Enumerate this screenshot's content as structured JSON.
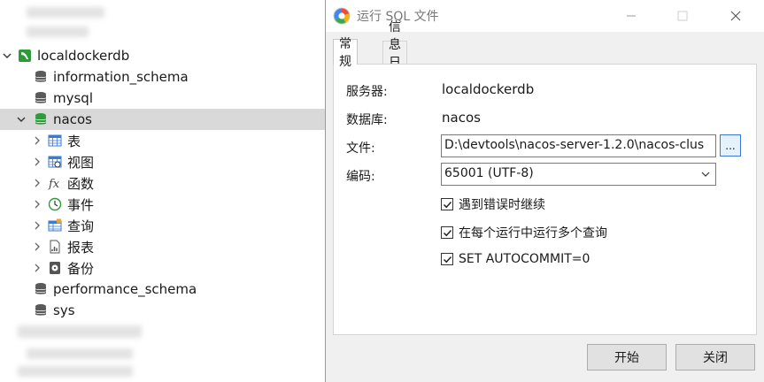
{
  "tree": {
    "connection": "localdockerdb",
    "databases": [
      "information_schema",
      "mysql",
      "nacos",
      "performance_schema",
      "sys"
    ],
    "nacos_children": [
      "表",
      "视图",
      "函数",
      "事件",
      "查询",
      "报表",
      "备份"
    ]
  },
  "dialog": {
    "title": "运行 SQL 文件",
    "tabs": [
      "常规",
      "信息日志"
    ],
    "fields": {
      "server_label": "服务器:",
      "server_value": "localdockerdb",
      "database_label": "数据库:",
      "database_value": "nacos",
      "file_label": "文件:",
      "file_value": "D:\\devtools\\nacos-server-1.2.0\\nacos-clus",
      "browse_label": "...",
      "encoding_label": "编码:",
      "encoding_value": "65001 (UTF-8)"
    },
    "options": [
      {
        "label": "遇到错误时继续",
        "checked": true
      },
      {
        "label": "在每个运行中运行多个查询",
        "checked": true
      },
      {
        "label": "SET AUTOCOMMIT=0",
        "checked": true
      }
    ],
    "buttons": {
      "start": "开始",
      "close": "关闭"
    }
  },
  "colors": {
    "selection": "#d9d9d9",
    "db_icon": "#5a5a5a",
    "db_icon_active": "#2e9b3a",
    "connection_icon": "#2e9b3a",
    "browse_border": "#3c78d8"
  }
}
